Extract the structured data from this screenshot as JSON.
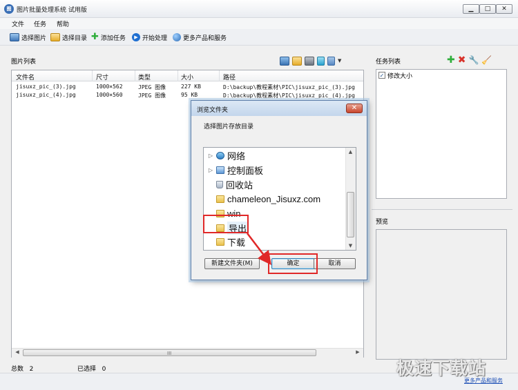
{
  "window": {
    "title": "图片批量处理系统 试用版",
    "app_icon_text": "图"
  },
  "window_buttons": {
    "minimize": "▁",
    "maximize": "□",
    "close": "✕"
  },
  "menu": [
    "文件",
    "任务",
    "帮助"
  ],
  "toolbar": [
    {
      "label": "选择图片",
      "icon": "picture-icon",
      "color": "#4a86c8"
    },
    {
      "label": "选择目录",
      "icon": "folder-icon",
      "color": "#e9b32f"
    },
    {
      "label": "添加任务",
      "icon": "plus-icon",
      "color": "#2fae3b"
    },
    {
      "label": "开始处理",
      "icon": "play-icon",
      "color": "#1f6fd1"
    },
    {
      "label": "更多产品和服务",
      "icon": "globe-icon",
      "color": "#2c6bb5"
    }
  ],
  "image_list": {
    "label": "图片列表",
    "columns": [
      "文件名",
      "尺寸",
      "类型",
      "大小",
      "路径"
    ],
    "rows": [
      [
        "jisuxz_pic_(3).jpg",
        "1000×562",
        "JPEG 图像",
        "227 KB",
        "D:\\backup\\教程素材\\PIC\\jisuxz_pic_(3).jpg"
      ],
      [
        "jisuxz_pic_(4).jpg",
        "1000×560",
        "JPEG 图像",
        "95 KB",
        "D:\\backup\\教程素材\\PIC\\jisuxz_pic_(4).jpg"
      ]
    ],
    "hscroll_grip": "III"
  },
  "status": {
    "total_label": "总数",
    "total": "2",
    "selected_label": "已选择",
    "selected": "0",
    "more_link": "更多产品和服务"
  },
  "task_list": {
    "label": "任务列表",
    "items": [
      {
        "label": "修改大小",
        "checked": true,
        "mark": "✓"
      }
    ]
  },
  "preview": {
    "label": "预览"
  },
  "dialog": {
    "title": "浏览文件夹",
    "close": "✕",
    "prompt": "选择图片存放目录",
    "tree": [
      {
        "label": "网络",
        "expander": "▷",
        "icon": "network-icon"
      },
      {
        "label": "控制面板",
        "expander": "▷",
        "icon": "control-panel-icon"
      },
      {
        "label": "回收站",
        "expander": "",
        "icon": "recycle-bin-icon"
      },
      {
        "label": "chameleon_Jisuxz.com",
        "expander": "",
        "icon": "folder-icon"
      },
      {
        "label": "win",
        "expander": "",
        "icon": "folder-icon"
      },
      {
        "label": "导出",
        "expander": "",
        "icon": "folder-icon",
        "selected": true
      },
      {
        "label": "下载",
        "expander": "",
        "icon": "folder-icon"
      }
    ],
    "scroll_up": "▲",
    "scroll_down": "▼",
    "buttons": {
      "new_folder": "新建文件夹(M)",
      "ok": "确定",
      "cancel": "取消"
    }
  },
  "annotation_color": "#e02828",
  "watermark": "极速下载站"
}
